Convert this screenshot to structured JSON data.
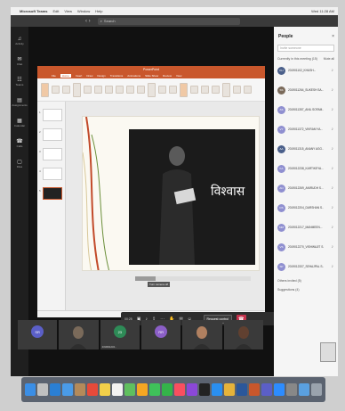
{
  "menubar": {
    "app": "Microsoft Teams",
    "items": [
      "Edit",
      "View",
      "Window",
      "Help"
    ],
    "status": "Wed 11:28 AM"
  },
  "titlebar": {
    "search_placeholder": "Search"
  },
  "rail": {
    "items": [
      {
        "label": "Activity",
        "icon": "bell-icon"
      },
      {
        "label": "Chat",
        "icon": "chat-icon"
      },
      {
        "label": "Teams",
        "icon": "teams-icon"
      },
      {
        "label": "Assignments",
        "icon": "clipboard-icon"
      },
      {
        "label": "Calendar",
        "icon": "calendar-icon"
      },
      {
        "label": "Calls",
        "icon": "phone-icon"
      },
      {
        "label": "Files",
        "icon": "file-icon"
      }
    ]
  },
  "ppt": {
    "window_title": "PowerPoint",
    "tabs": [
      "File",
      "Home",
      "Insert",
      "Draw",
      "Design",
      "Transitions",
      "Animations",
      "Slide Show",
      "Review",
      "View"
    ],
    "active_tab": "Home",
    "slide_count": 5,
    "slide_word": "विश्वास"
  },
  "caption_chip": "Turn camera off",
  "toolbar": {
    "time": "00:25",
    "request_control": "Request control"
  },
  "presenter": "Sadhna Rathore",
  "tiles": [
    {
      "kind": "avatar",
      "initials": "SR",
      "label": "",
      "color": "#5b5fc7"
    },
    {
      "kind": "face",
      "label": "",
      "color": "#7a6a5a"
    },
    {
      "kind": "avatar",
      "initials": "23",
      "label": "2319011234...",
      "color": "#2e8b57"
    },
    {
      "kind": "avatar",
      "initials": "RR",
      "label": "",
      "color": "#8b5fc7"
    },
    {
      "kind": "face",
      "label": "",
      "color": "#b08060"
    },
    {
      "kind": "face",
      "label": "",
      "color": "#604030"
    }
  ],
  "people": {
    "title": "People",
    "invite_placeholder": "Invite someone",
    "current_label": "Currently in this meeting (15)",
    "mute_all": "Mute all",
    "participants": [
      {
        "name": "201901102_KHUSH...",
        "color": "#4a5f8a",
        "initials": "KH"
      },
      {
        "name": "2019011264_SUKESH SA...",
        "color": "#7a6a5a",
        "initials": "SS"
      },
      {
        "name": "2019011357_ANIL SOFAM...",
        "color": "#8f8fd0",
        "initials": "AS"
      },
      {
        "name": "2019011372_VIKRAM YA...",
        "color": "#8f8fd0",
        "initials": "VY"
      },
      {
        "name": "2019011315_ANANY AGG...",
        "color": "#4a5f8a",
        "initials": "AA"
      },
      {
        "name": "2019012238_KARTIKEYA...",
        "color": "#8f8fd0",
        "initials": "KA"
      },
      {
        "name": "2019012269_ANIRUDH S...",
        "color": "#8f8fd0",
        "initials": "AN"
      },
      {
        "name": "2019012204_DARSHAN S...",
        "color": "#8f8fd0",
        "initials": "DS"
      },
      {
        "name": "2019012217_MANMEEN...",
        "color": "#8f8fd0",
        "initials": "MM"
      },
      {
        "name": "2019012270_VISHWAJIT S...",
        "color": "#8f8fd0",
        "initials": "VS"
      },
      {
        "name": "2019012337_SEHAJPAL S...",
        "color": "#8f8fd0",
        "initials": "SP"
      }
    ],
    "others": "Others invited (5)",
    "suggestions": "Suggestions (4)"
  },
  "dock": {
    "icons": [
      {
        "name": "finder-icon",
        "color": "#3a8ee6"
      },
      {
        "name": "launchpad-icon",
        "color": "#c0c0c0"
      },
      {
        "name": "safari-icon",
        "color": "#2a7fd4"
      },
      {
        "name": "mail-icon",
        "color": "#4a9be8"
      },
      {
        "name": "contacts-icon",
        "color": "#b48a5a"
      },
      {
        "name": "calendar-icon",
        "color": "#e64a3a"
      },
      {
        "name": "notes-icon",
        "color": "#f3d04a"
      },
      {
        "name": "reminders-icon",
        "color": "#f2f2f2"
      },
      {
        "name": "maps-icon",
        "color": "#5fbf5f"
      },
      {
        "name": "photos-icon",
        "color": "#f5a623"
      },
      {
        "name": "messages-icon",
        "color": "#3fc15a"
      },
      {
        "name": "facetime-icon",
        "color": "#34b44a"
      },
      {
        "name": "music-icon",
        "color": "#f94f5f"
      },
      {
        "name": "podcasts-icon",
        "color": "#8b48d8"
      },
      {
        "name": "tv-icon",
        "color": "#222222"
      },
      {
        "name": "appstore-icon",
        "color": "#2a8ff0"
      },
      {
        "name": "chrome-icon",
        "color": "#e6b33a"
      },
      {
        "name": "word-icon",
        "color": "#2b579a"
      },
      {
        "name": "powerpoint-icon",
        "color": "#c9572c"
      },
      {
        "name": "teams-app-icon",
        "color": "#5b5fc7"
      },
      {
        "name": "zoom-icon",
        "color": "#2d8cff"
      },
      {
        "name": "preferences-icon",
        "color": "#888888"
      },
      {
        "name": "help-icon",
        "color": "#5aa0e0"
      },
      {
        "name": "trash-icon",
        "color": "#9aa3ad"
      }
    ]
  }
}
